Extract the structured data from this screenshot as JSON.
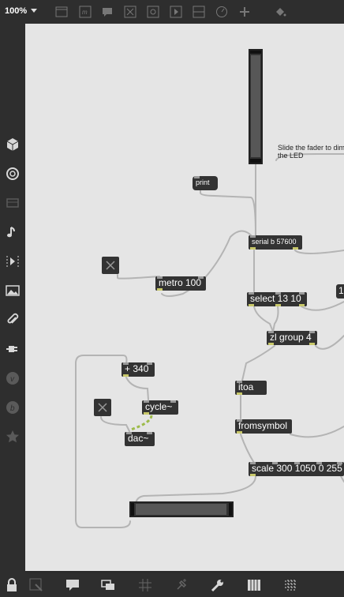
{
  "toolbar": {
    "zoom": "100%",
    "icons": [
      "presentation-icon",
      "edit-lock-icon",
      "comment-icon",
      "x-box-icon",
      "grid-box-icon",
      "media-icon",
      "minus-box-icon",
      "dial-icon",
      "plus-icon",
      "paint-bucket-icon"
    ]
  },
  "sidebar": {
    "icons": [
      "cube-icon",
      "circle-icon",
      "bar-icon",
      "music-note-icon",
      "step-icon",
      "image-icon",
      "paperclip-icon",
      "plug-icon",
      "v-icon",
      "b-icon",
      "star-icon"
    ]
  },
  "bottombar": {
    "icons": [
      "lock-icon",
      "edit-mode-icon",
      "presentation-icon",
      "windows-icon",
      "grid-icon",
      "pin-icon",
      "wrench-icon",
      "piano-icon",
      "keyboard-icon"
    ]
  },
  "patch": {
    "comment": "Slide the fader to dim\nthe LED",
    "objects": {
      "print": "print",
      "serial": "serial b 57600",
      "metro": "metro 100",
      "select": "select 13 10",
      "zl": "zl group 4",
      "itoa": "itoa",
      "fromsymbol": "fromsymbol",
      "scale": "scale 300 1050 0 255",
      "plus": "+ 340",
      "cycle": "cycle~",
      "dac": "dac~"
    },
    "partial_label": "1"
  },
  "colors": {
    "canvas": "#e5e5e5",
    "chrome": "#2e2e2e",
    "object": "#333333",
    "patch_cord": "#b4b4b4",
    "signal_cord": "#9dbb4a"
  }
}
